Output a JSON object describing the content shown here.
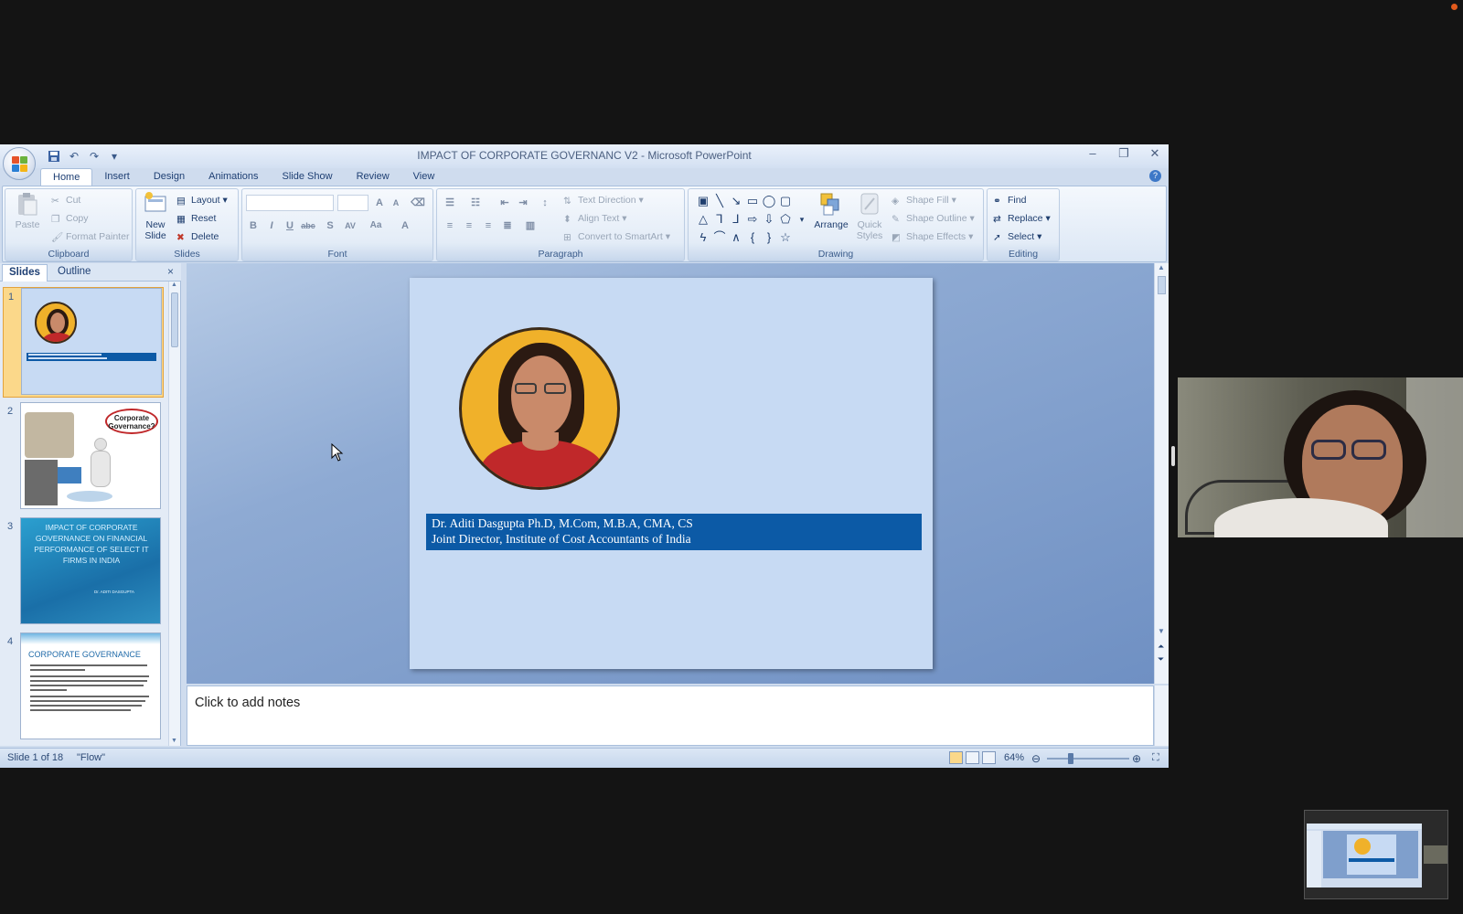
{
  "window": {
    "title": "IMPACT OF CORPORATE GOVERNANC V2 - Microsoft PowerPoint",
    "minimize": "–",
    "restore": "❐",
    "close": "✕"
  },
  "ribbon_tabs": [
    "Home",
    "Insert",
    "Design",
    "Animations",
    "Slide Show",
    "Review",
    "View"
  ],
  "ribbon": {
    "clipboard": {
      "label": "Clipboard",
      "paste": "Paste",
      "cut": "Cut",
      "copy": "Copy",
      "format_painter": "Format Painter"
    },
    "slides": {
      "label": "Slides",
      "new_slide_line1": "New",
      "new_slide_line2": "Slide",
      "layout": "Layout",
      "reset": "Reset",
      "delete": "Delete"
    },
    "font": {
      "label": "Font"
    },
    "paragraph": {
      "label": "Paragraph",
      "text_direction": "Text Direction",
      "align_text": "Align Text",
      "convert_smartart": "Convert to SmartArt"
    },
    "drawing": {
      "label": "Drawing",
      "arrange": "Arrange",
      "quick_styles_line1": "Quick",
      "quick_styles_line2": "Styles",
      "shape_fill": "Shape Fill",
      "shape_outline": "Shape Outline",
      "shape_effects": "Shape Effects"
    },
    "editing": {
      "label": "Editing",
      "find": "Find",
      "replace": "Replace",
      "select": "Select"
    }
  },
  "panel": {
    "tab_slides": "Slides",
    "tab_outline": "Outline",
    "close": "×",
    "thumbnails": [
      {
        "number": "1"
      },
      {
        "number": "2",
        "bubble": "Corporate Governance?"
      },
      {
        "number": "3",
        "title": "IMPACT OF CORPORATE GOVERNANCE ON FINANCIAL PERFORMANCE OF SELECT IT FIRMS IN INDIA",
        "author": "Dr. ADITI DASGUPTA"
      },
      {
        "number": "4",
        "title": "CORPORATE GOVERNANCE"
      }
    ]
  },
  "slide": {
    "line1": "Dr. Aditi Dasgupta Ph.D, M.Com, M.B.A, CMA, CS",
    "line2": "Joint Director, Institute of Cost Accountants of India"
  },
  "notes": {
    "placeholder": "Click to add notes"
  },
  "status": {
    "slide_count": "Slide 1 of 18",
    "theme": "\"Flow\"",
    "zoom": "64%"
  },
  "colors": {
    "slide_bg": "#c7daf3",
    "name_bar": "#0c5aa6",
    "portrait_bg": "#f0b12a"
  }
}
